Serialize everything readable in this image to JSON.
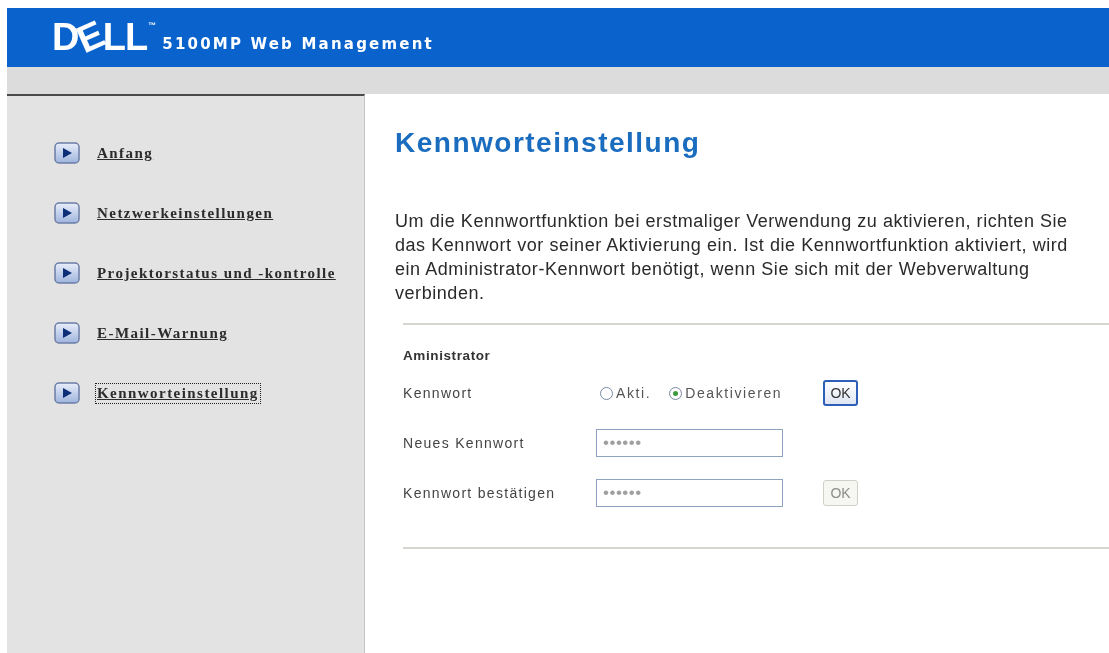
{
  "header": {
    "logo": "DELL",
    "trademark": "™",
    "title": "5100MP Web Management"
  },
  "sidebar": {
    "items": [
      {
        "label": "Anfang",
        "selected": false
      },
      {
        "label": "Netzwerkeinstellungen",
        "selected": false
      },
      {
        "label": "Projektorstatus und -kontrolle",
        "selected": false
      },
      {
        "label": "E-Mail-Warnung",
        "selected": false
      },
      {
        "label": "Kennworteinstellung",
        "selected": true
      }
    ]
  },
  "main": {
    "title": "Kennworteinstellung",
    "description_lines": [
      "Um die Kennwortfunktion bei erstmaliger Verwendung zu aktivieren, richten Sie",
      "das Kennwort vor seiner Aktivierung ein. Ist die Kennwortfunktion aktiviert, wird",
      "ein Administrator-Kennwort benötigt, wenn Sie sich mit der Webverwaltung",
      "verbinden."
    ],
    "section": {
      "title": "Aministrator",
      "rows": [
        {
          "kind": "radio",
          "label": "Kennwort",
          "options": [
            {
              "label": "Akti.",
              "selected": false
            },
            {
              "label": "Deaktivieren",
              "selected": true
            }
          ],
          "button": {
            "label": "OK",
            "disabled": false
          }
        },
        {
          "kind": "password",
          "label": "Neues Kennwort",
          "value": "••••••"
        },
        {
          "kind": "password",
          "label": "Kennwort bestätigen",
          "value": "••••••",
          "button": {
            "label": "OK",
            "disabled": true
          }
        }
      ]
    }
  }
}
